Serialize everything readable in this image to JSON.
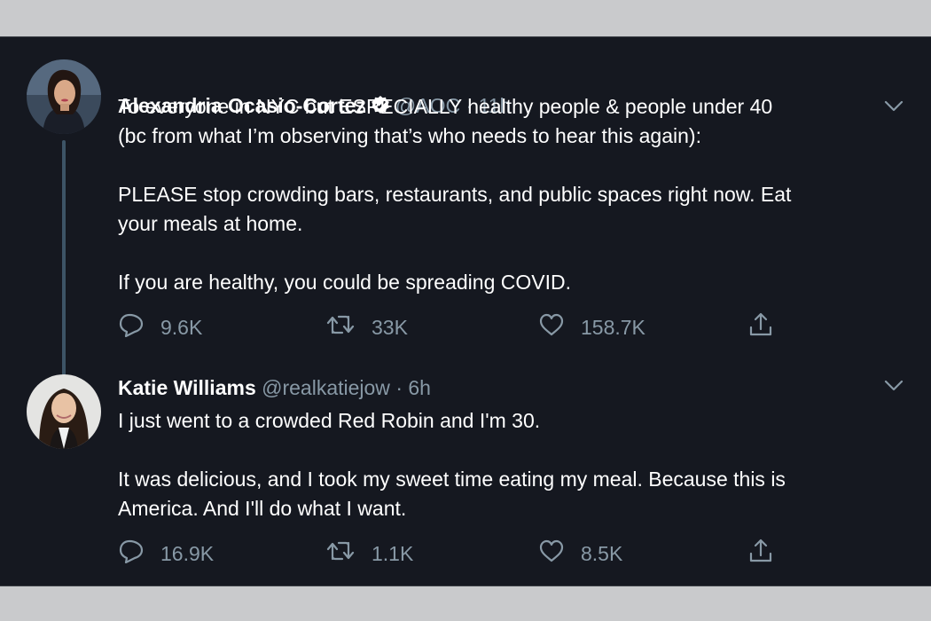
{
  "tweets": [
    {
      "name": "Alexandria Ocasio-Cortez",
      "verified": true,
      "handle": "@AOC",
      "separator": "·",
      "time": "11h",
      "lines": [
        "To everyone in NYC but ESPECIALLY healthy people & people under 40",
        "(bc from what I’m observing that’s who needs to hear this again):",
        "",
        "PLEASE stop crowding bars, restaurants, and public spaces right now. Eat",
        "your meals at home.",
        "",
        "If you are healthy, you could be spreading COVID."
      ],
      "replies": "9.6K",
      "retweets": "33K",
      "likes": "158.7K"
    },
    {
      "name": "Katie Williams",
      "verified": false,
      "handle": "@realkatiejow",
      "separator": "·",
      "time": "6h",
      "lines": [
        "I just went to a crowded Red Robin and I'm 30.",
        "",
        "It was delicious, and I took my sweet time eating my meal. Because this is",
        "America. And I'll do what I want."
      ],
      "replies": "16.9K",
      "retweets": "1.1K",
      "likes": "8.5K"
    }
  ],
  "icons": {
    "reply": "speech-bubble-icon",
    "retweet": "retweet-icon",
    "like": "heart-icon",
    "share": "share-icon",
    "more": "chevron-down-icon",
    "verified": "verified-badge-icon"
  },
  "colors": {
    "background": "#151820",
    "text": "#ffffff",
    "muted": "#8899a6",
    "verified": "#ffffff",
    "thread_line": "#3d5466",
    "outer": "#c9cacc"
  }
}
